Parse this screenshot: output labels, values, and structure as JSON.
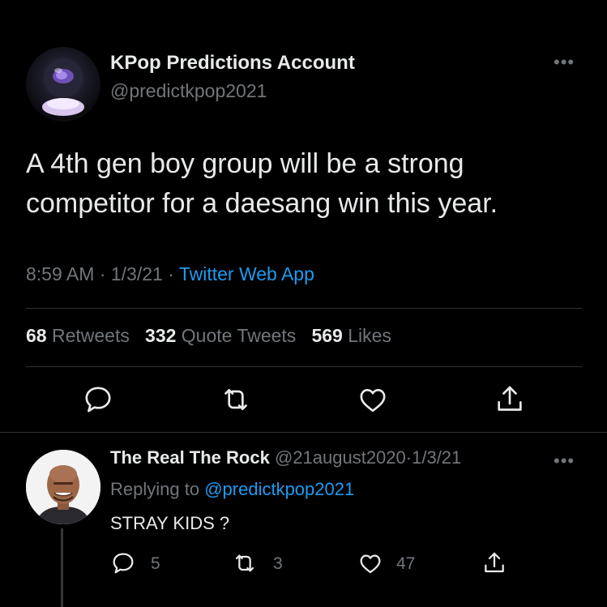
{
  "tweet": {
    "author_name": "KPop Predictions Account",
    "author_handle": "@predictkpop2021",
    "text": "A 4th gen boy group will be a strong competitor for a daesang win this year.",
    "time": "8:59 AM",
    "date": "1/3/21",
    "source": "Twitter Web App",
    "separator": "·",
    "more": "•••",
    "stats": {
      "retweets_count": "68",
      "retweets_label": "Retweets",
      "quotes_count": "332",
      "quotes_label": "Quote Tweets",
      "likes_count": "569",
      "likes_label": "Likes"
    },
    "icons": [
      "reply-icon",
      "retweet-icon",
      "like-icon",
      "share-icon"
    ]
  },
  "reply": {
    "author_name": "The Real The Rock",
    "author_handle": "@21august2020",
    "separator": "·",
    "date": "1/3/21",
    "replying_prefix": "Replying to",
    "replying_handle": "@predictkpop2021",
    "text": "STRAY KIDS ?",
    "more": "•••",
    "reply_count": "5",
    "retweet_count": "3",
    "like_count": "47"
  },
  "colors": {
    "background": "#000000",
    "text": "#e7e9ea",
    "secondary": "#71767b",
    "accent": "#1d9bf0",
    "divider": "#2f3336"
  }
}
